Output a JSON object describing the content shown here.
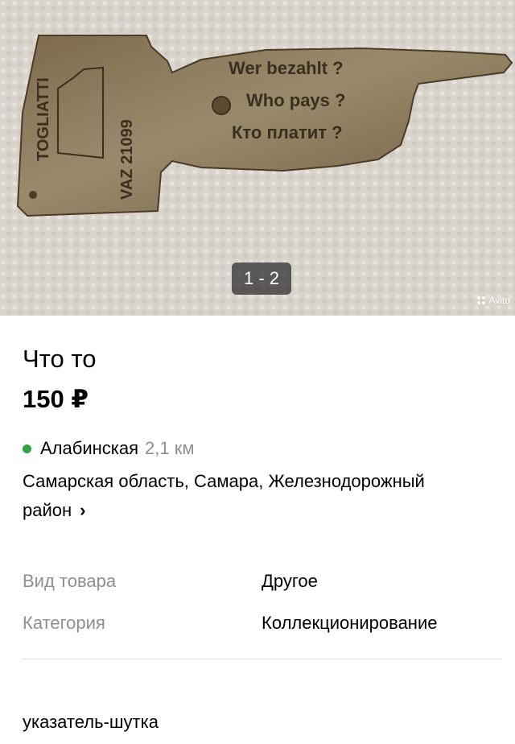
{
  "gallery": {
    "counter": "1 - 2",
    "watermark": "Avito",
    "photo_text": [
      "Wer bezahlt ?",
      "Who pays ?",
      "Кто платит ?",
      "TOGLIATTI",
      "VAZ 21099"
    ]
  },
  "listing": {
    "title": "Что то",
    "price": "150 ₽"
  },
  "location": {
    "metro_station": "Алабинская",
    "metro_distance": "2,1 км",
    "metro_color": "#2fa344",
    "address_line1": "Самарская область, Самара, Железнодорожный",
    "address_line2": "район"
  },
  "params": [
    {
      "key": "Вид товара",
      "value": "Другое"
    },
    {
      "key": "Категория",
      "value": "Коллекционирование"
    }
  ],
  "description": "указатель-шутка"
}
